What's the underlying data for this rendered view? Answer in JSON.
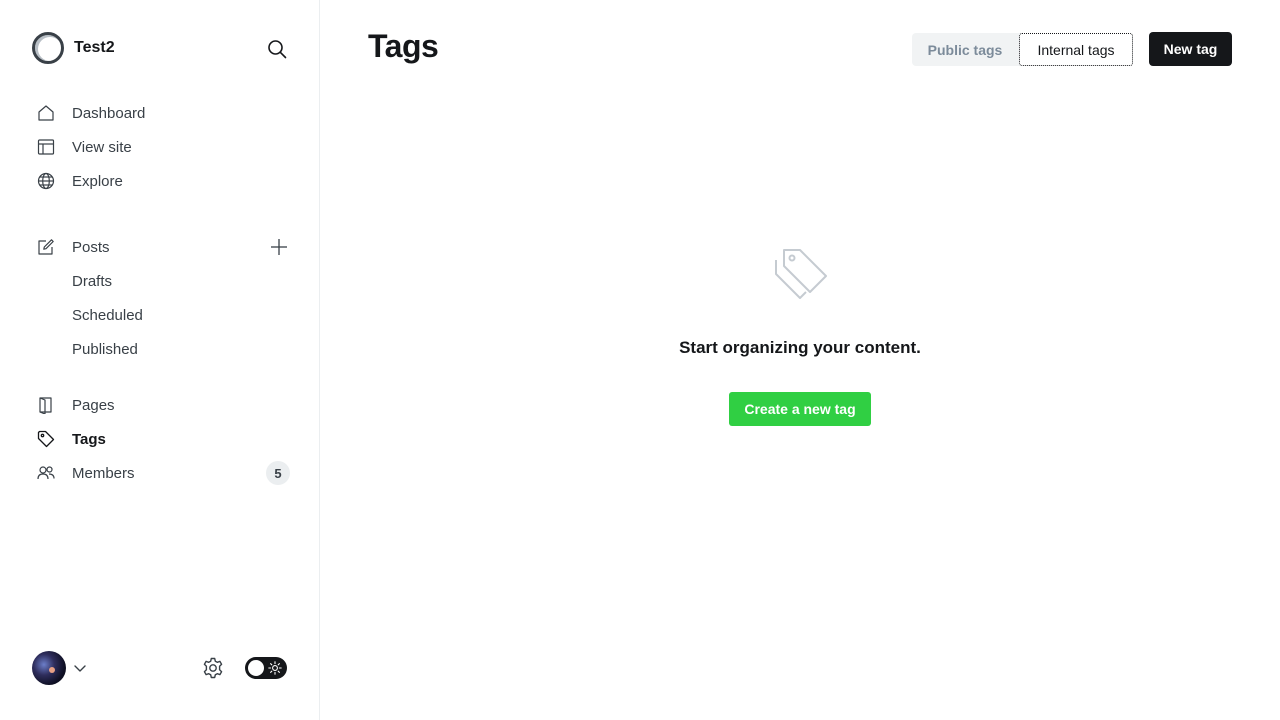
{
  "site": {
    "name": "Test2"
  },
  "sidebar": {
    "primary": [
      {
        "label": "Dashboard",
        "icon": "home-icon"
      },
      {
        "label": "View site",
        "icon": "layout-icon"
      },
      {
        "label": "Explore",
        "icon": "globe-icon"
      }
    ],
    "posts": {
      "label": "Posts",
      "icon": "edit-icon",
      "add_icon": "plus-icon"
    },
    "post_filters": [
      {
        "label": "Drafts"
      },
      {
        "label": "Scheduled"
      },
      {
        "label": "Published"
      }
    ],
    "secondary": [
      {
        "label": "Pages",
        "icon": "page-icon"
      },
      {
        "label": "Tags",
        "icon": "tag-icon",
        "active": true
      },
      {
        "label": "Members",
        "icon": "members-icon",
        "count": "5"
      }
    ],
    "footer": {
      "avatar": "user-avatar",
      "settings_icon": "gear-icon",
      "theme": "dark-mode-toggle"
    }
  },
  "main": {
    "title": "Tags",
    "segmented": {
      "public": "Public tags",
      "internal": "Internal tags",
      "selected": "internal"
    },
    "new_button": "New tag",
    "empty_state": {
      "icon": "tag-icon",
      "title": "Start organizing your content.",
      "button": "Create a new tag"
    }
  },
  "colors": {
    "accent_green": "#30cf43",
    "dark": "#15171a",
    "muted": "#7c8b9a"
  }
}
